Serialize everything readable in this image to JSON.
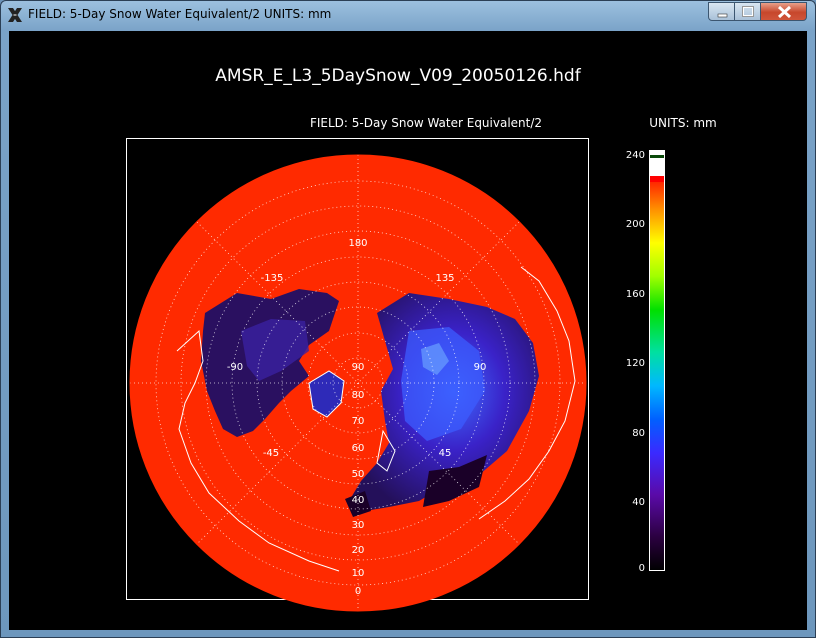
{
  "window": {
    "title": "FIELD: 5-Day Snow Water Equivalent/2  UNITS: mm",
    "icon": "x11-icon",
    "controls": [
      "minimize-icon",
      "maximize-icon",
      "close-icon"
    ]
  },
  "plot": {
    "title": "AMSR_E_L3_5DaySnow_V09_20050126.hdf",
    "field_label": "FIELD: 5-Day Snow Water Equivalent/2",
    "units_label": "UNITS: mm",
    "lon_labels": [
      "180",
      "-135",
      "135",
      "-90",
      "90",
      "-45",
      "45"
    ],
    "lat_labels": [
      "90",
      "80",
      "70",
      "60",
      "50",
      "40",
      "30",
      "20",
      "10",
      "0"
    ],
    "colors": {
      "ocean": "#ff2a00",
      "land_low": "#1a0030",
      "snow_mid": "#5a1aa8",
      "snow_high": "#2255ff",
      "coast": "#ffffff",
      "grid": "#ffffff"
    }
  },
  "colorbar": {
    "ticks": [
      "240",
      "200",
      "160",
      "120",
      "80",
      "40",
      "0"
    ],
    "range": [
      0,
      240
    ]
  }
}
